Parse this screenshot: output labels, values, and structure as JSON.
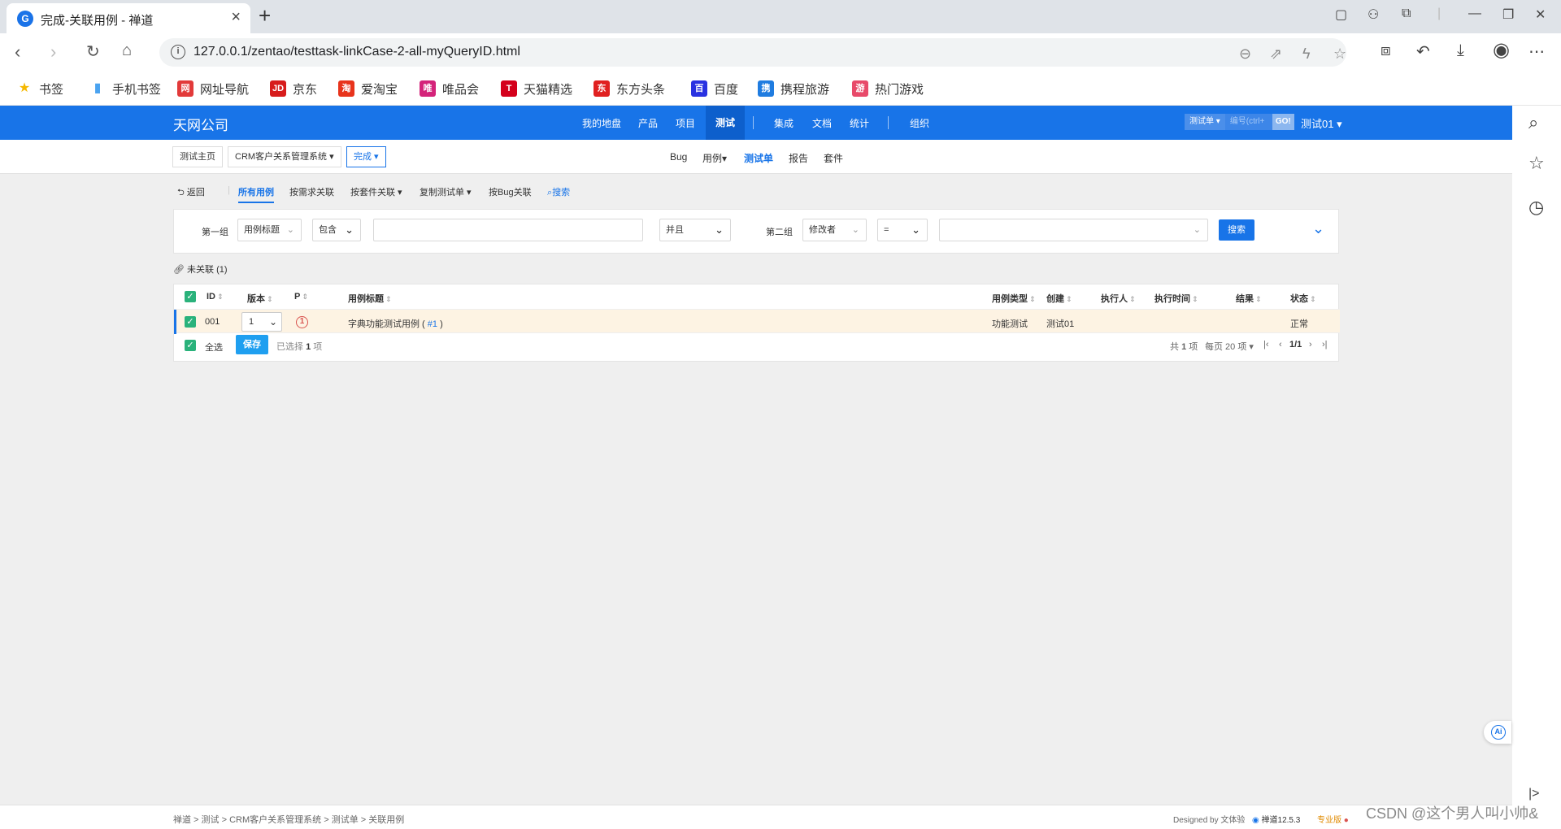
{
  "browser": {
    "tab_title": "完成-关联用例 - 禅道",
    "url": "127.0.0.1/zentao/testtask-linkCase-2-all-myQueryID.html",
    "bookmarks": [
      {
        "label": "书签",
        "icon": "star-icon",
        "color": "#f5b800"
      },
      {
        "label": "手机书签",
        "icon": "phone-icon",
        "color": "#4aa3f0"
      },
      {
        "label": "网址导航",
        "icon": "nav-icon",
        "color": "#e23a3a"
      },
      {
        "label": "京东",
        "icon": "jd-icon",
        "color": "#d71c1c"
      },
      {
        "label": "爱淘宝",
        "icon": "taobao-icon",
        "color": "#e8341c"
      },
      {
        "label": "唯品会",
        "icon": "vip-icon",
        "color": "#d4237a"
      },
      {
        "label": "天猫精选",
        "icon": "tmall-icon",
        "color": "#d4001c"
      },
      {
        "label": "东方头条",
        "icon": "toutiao-icon",
        "color": "#e02020"
      },
      {
        "label": "百度",
        "icon": "baidu-icon",
        "color": "#2932e1"
      },
      {
        "label": "携程旅游",
        "icon": "ctrip-icon",
        "color": "#1f7ce0"
      },
      {
        "label": "热门游戏",
        "icon": "game-icon",
        "color": "#e84a6a"
      }
    ]
  },
  "header": {
    "brand": "天网公司",
    "nav": [
      "我的地盘",
      "产品",
      "项目",
      "测试",
      "集成",
      "文档",
      "统计",
      "组织"
    ],
    "active_nav": "测试",
    "search_type": "测试单",
    "search_placeholder": "编号(ctrl+",
    "search_go": "GO!",
    "user": "测试01"
  },
  "subheader": {
    "breadcrumbs": [
      "测试主页",
      "CRM客户关系管理系统",
      "完成"
    ],
    "nav": [
      "Bug",
      "用例",
      "测试单",
      "报告",
      "套件"
    ],
    "active_nav": "测试单"
  },
  "toolbar": {
    "back": "返回",
    "items": [
      "所有用例",
      "按需求关联",
      "按套件关联",
      "复制测试单",
      "按Bug关联"
    ],
    "search": "搜索"
  },
  "search": {
    "group1_label": "第一组",
    "group1_field": "用例标题",
    "group1_op": "包含",
    "group1_value": "",
    "and_or": "并且",
    "group2_label": "第二组",
    "group2_field": "修改者",
    "group2_op": "=",
    "group2_value": "",
    "button": "搜索"
  },
  "unlinked_label": "未关联 (1)",
  "table": {
    "headers": [
      "ID",
      "版本",
      "P",
      "用例标题",
      "用例类型",
      "创建",
      "执行人",
      "执行时间",
      "结果",
      "状态"
    ],
    "rows": [
      {
        "id": "001",
        "version": "1",
        "priority": "1",
        "title": "字典功能测试用例",
        "title_link": "#1",
        "type": "功能测试",
        "creator": "测试01",
        "executor": "",
        "exec_time": "",
        "result": "",
        "status": "正常"
      }
    ],
    "footer": {
      "select_all": "全选",
      "save": "保存",
      "selected_prefix": "已选择",
      "selected_count": "1",
      "selected_suffix": "项",
      "total_prefix": "共",
      "total_count": "1",
      "total_suffix": "项",
      "per_page": "每页 20 项",
      "page": "1/1"
    }
  },
  "footer": {
    "breadcrumbs": [
      "禅道",
      "测试",
      "CRM客户关系管理系统",
      "测试单",
      "关联用例"
    ],
    "designed_by": "Designed by 文体验",
    "version": "禅道12.5.3",
    "edition": "专业版",
    "watermark": "CSDN @这个男人叫小帅&"
  },
  "colors": {
    "primary": "#1874e8",
    "checkbox": "#2ab27b",
    "row_highlight": "#fdf3e3",
    "priority": "#d9534f"
  }
}
